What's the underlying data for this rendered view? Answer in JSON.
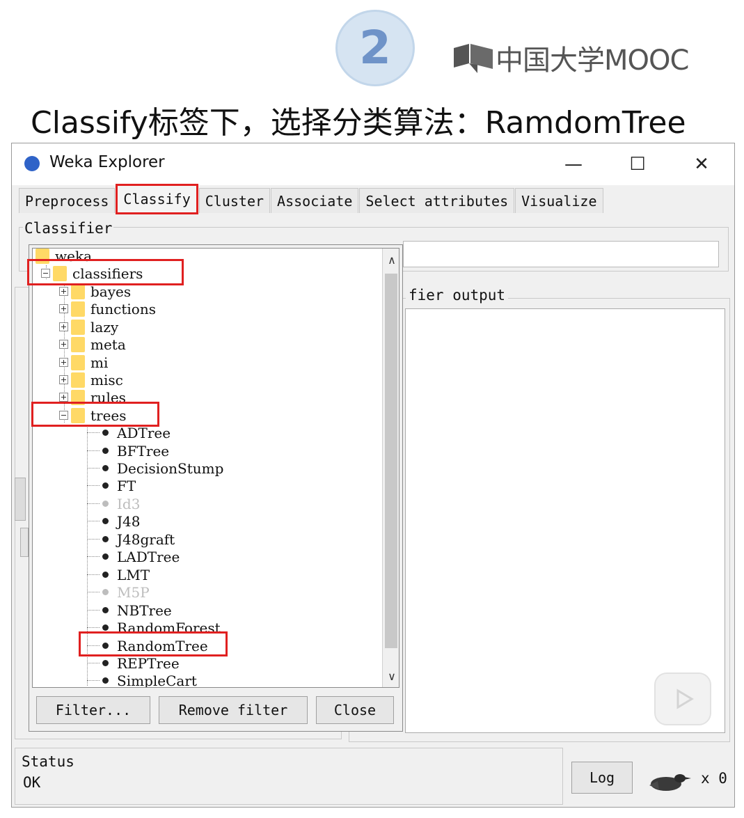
{
  "slide": {
    "step_number": "2",
    "logo_text": "中国大学MOOC",
    "title": "Classify标签下，选择分类算法：RamdomTree"
  },
  "window": {
    "title": "Weka Explorer",
    "controls": {
      "minimize": "—",
      "maximize": "☐",
      "close": "✕"
    }
  },
  "tabs": [
    "Preprocess",
    "Classify",
    "Cluster",
    "Associate",
    "Select attributes",
    "Visualize"
  ],
  "active_tab": "Classify",
  "classifier_label": "Classifier",
  "output_label": "fier output",
  "tree": {
    "root": "weka",
    "classifiers": "classifiers",
    "groups": [
      "bayes",
      "functions",
      "lazy",
      "meta",
      "mi",
      "misc",
      "rules"
    ],
    "trees_folder": "trees",
    "tree_items": [
      {
        "label": "ADTree",
        "enabled": true
      },
      {
        "label": "BFTree",
        "enabled": true
      },
      {
        "label": "DecisionStump",
        "enabled": true
      },
      {
        "label": "FT",
        "enabled": true
      },
      {
        "label": "Id3",
        "enabled": false
      },
      {
        "label": "J48",
        "enabled": true
      },
      {
        "label": "J48graft",
        "enabled": true
      },
      {
        "label": "LADTree",
        "enabled": true
      },
      {
        "label": "LMT",
        "enabled": true
      },
      {
        "label": "M5P",
        "enabled": false
      },
      {
        "label": "NBTree",
        "enabled": true
      },
      {
        "label": "RandomForest",
        "enabled": true
      },
      {
        "label": "RandomTree",
        "enabled": true
      },
      {
        "label": "REPTree",
        "enabled": true
      },
      {
        "label": "SimpleCart",
        "enabled": true
      }
    ],
    "scroll_up": "∧",
    "scroll_down": "∨"
  },
  "buttons": {
    "filter": "Filter...",
    "remove_filter": "Remove filter",
    "close": "Close",
    "log": "Log"
  },
  "status": {
    "label": "Status",
    "value": "OK",
    "x_count": "x 0"
  },
  "colors": {
    "highlight": "#e02020",
    "folder": "#ffd966",
    "badge": "#6f93c8"
  }
}
